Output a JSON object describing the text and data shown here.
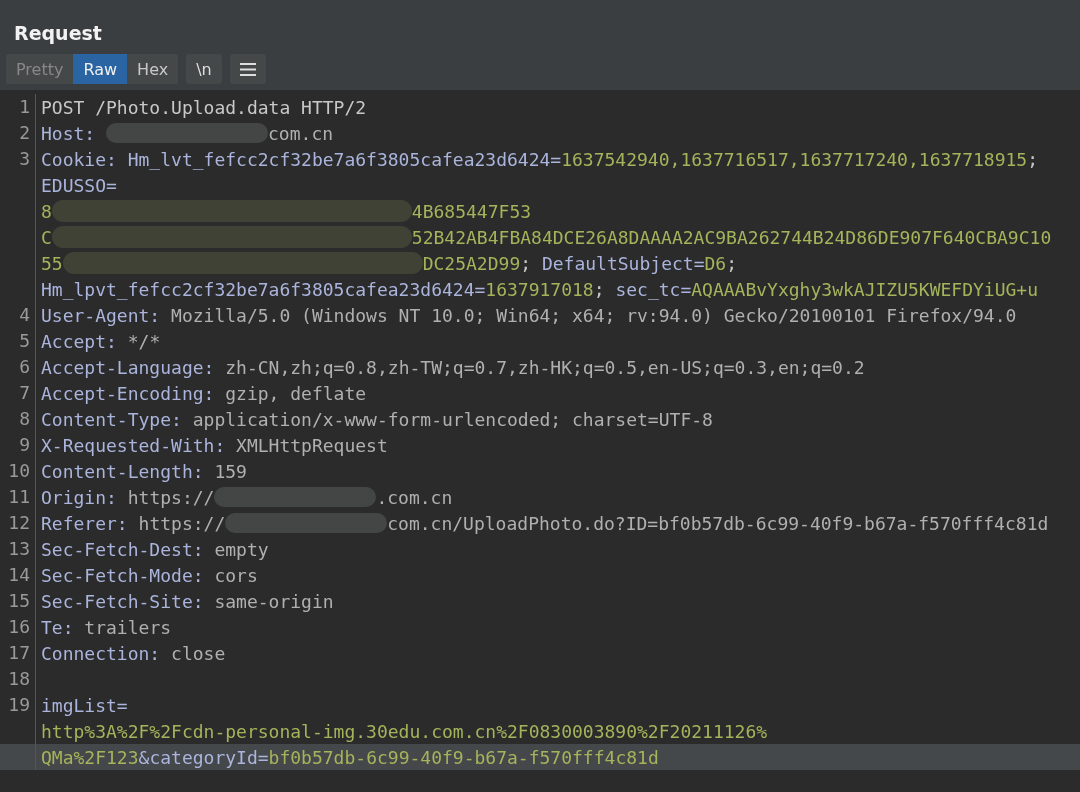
{
  "panel": {
    "title": "Request"
  },
  "view_tabs": [
    {
      "label": "Pretty",
      "selected": false
    },
    {
      "label": "Raw",
      "selected": true
    },
    {
      "label": "Hex",
      "selected": false
    }
  ],
  "newline_toggle": {
    "label": "\\n"
  },
  "editor": {
    "rows": [
      {
        "number": "1",
        "selected": false,
        "segments": [
          {
            "kind": "plain",
            "text": "POST /Photo.Upload.data HTTP/2"
          }
        ]
      },
      {
        "number": "2",
        "selected": false,
        "segments": [
          {
            "kind": "name",
            "text": "Host: "
          },
          {
            "kind": "smudge"
          },
          {
            "kind": "value",
            "text": "com.cn"
          }
        ]
      },
      {
        "number": "3",
        "selected": false,
        "segments": [
          {
            "kind": "name",
            "text": "Cookie: Hm_lvt_fefcc2cf32be7a6f3805cafea23d6424="
          },
          {
            "kind": "cookie",
            "text": "1637542940,1637716517,1637717240,1637718915"
          },
          {
            "kind": "plain",
            "text": ";"
          }
        ]
      },
      {
        "selected": false,
        "segments": [
          {
            "kind": "name",
            "text": "EDUSSO="
          }
        ]
      },
      {
        "selected": false,
        "segments": [
          {
            "kind": "cookie",
            "text": "8"
          },
          {
            "kind": "smudge-wide"
          },
          {
            "kind": "cookie",
            "text": "4B685447F53"
          }
        ]
      },
      {
        "selected": false,
        "segments": [
          {
            "kind": "cookie",
            "text": "C"
          },
          {
            "kind": "smudge-wide"
          },
          {
            "kind": "cookie",
            "text": "52B42AB4FBA84DCE26A8DAAAA2AC9BA262744B24D86DE907F640CBA9C10"
          }
        ]
      },
      {
        "selected": false,
        "segments": [
          {
            "kind": "cookie",
            "text": "55"
          },
          {
            "kind": "smudge-wide"
          },
          {
            "kind": "cookie",
            "text": "DC25A2D99"
          },
          {
            "kind": "plain",
            "text": "; "
          },
          {
            "kind": "name",
            "text": "DefaultSubject="
          },
          {
            "kind": "cookie",
            "text": "D6"
          },
          {
            "kind": "plain",
            "text": ";"
          }
        ]
      },
      {
        "selected": false,
        "segments": [
          {
            "kind": "name",
            "text": "Hm_lpvt_fefcc2cf32be7a6f3805cafea23d6424="
          },
          {
            "kind": "cookie",
            "text": "1637917018"
          },
          {
            "kind": "plain",
            "text": "; "
          },
          {
            "kind": "name",
            "text": "sec_tc="
          },
          {
            "kind": "cookie",
            "text": "AQAAABvYxghy3wkAJIZU5KWEFDYiUG+u"
          }
        ]
      },
      {
        "number": "4",
        "selected": false,
        "segments": [
          {
            "kind": "name",
            "text": "User-Agent: "
          },
          {
            "kind": "value",
            "text": "Mozilla/5.0 (Windows NT 10.0; Win64; x64; rv:94.0) Gecko/20100101 Firefox/94.0"
          }
        ]
      },
      {
        "number": "5",
        "selected": false,
        "segments": [
          {
            "kind": "name",
            "text": "Accept: "
          },
          {
            "kind": "value",
            "text": "*/*"
          }
        ]
      },
      {
        "number": "6",
        "selected": false,
        "segments": [
          {
            "kind": "name",
            "text": "Accept-Language: "
          },
          {
            "kind": "value",
            "text": "zh-CN,zh;q=0.8,zh-TW;q=0.7,zh-HK;q=0.5,en-US;q=0.3,en;q=0.2"
          }
        ]
      },
      {
        "number": "7",
        "selected": false,
        "segments": [
          {
            "kind": "name",
            "text": "Accept-Encoding: "
          },
          {
            "kind": "value",
            "text": "gzip, deflate"
          }
        ]
      },
      {
        "number": "8",
        "selected": false,
        "segments": [
          {
            "kind": "name",
            "text": "Content-Type: "
          },
          {
            "kind": "value",
            "text": "application/x-www-form-urlencoded; charset=UTF-8"
          }
        ]
      },
      {
        "number": "9",
        "selected": false,
        "segments": [
          {
            "kind": "name",
            "text": "X-Requested-With: "
          },
          {
            "kind": "value",
            "text": "XMLHttpRequest"
          }
        ]
      },
      {
        "number": "10",
        "selected": false,
        "segments": [
          {
            "kind": "name",
            "text": "Content-Length: "
          },
          {
            "kind": "value",
            "text": "159"
          }
        ]
      },
      {
        "number": "11",
        "selected": false,
        "segments": [
          {
            "kind": "name",
            "text": "Origin: "
          },
          {
            "kind": "value",
            "text": "https://"
          },
          {
            "kind": "smudge"
          },
          {
            "kind": "value",
            "text": ".com.cn"
          }
        ]
      },
      {
        "number": "12",
        "selected": false,
        "segments": [
          {
            "kind": "name",
            "text": "Referer: "
          },
          {
            "kind": "value",
            "text": "https://"
          },
          {
            "kind": "smudge"
          },
          {
            "kind": "value",
            "text": "com.cn/UploadPhoto.do?ID=bf0b57db-6c99-40f9-b67a-f570fff4c81d"
          }
        ]
      },
      {
        "number": "13",
        "selected": false,
        "segments": [
          {
            "kind": "name",
            "text": "Sec-Fetch-Dest: "
          },
          {
            "kind": "value",
            "text": "empty"
          }
        ]
      },
      {
        "number": "14",
        "selected": false,
        "segments": [
          {
            "kind": "name",
            "text": "Sec-Fetch-Mode: "
          },
          {
            "kind": "value",
            "text": "cors"
          }
        ]
      },
      {
        "number": "15",
        "selected": false,
        "segments": [
          {
            "kind": "name",
            "text": "Sec-Fetch-Site: "
          },
          {
            "kind": "value",
            "text": "same-origin"
          }
        ]
      },
      {
        "number": "16",
        "selected": false,
        "segments": [
          {
            "kind": "name",
            "text": "Te: "
          },
          {
            "kind": "value",
            "text": "trailers"
          }
        ]
      },
      {
        "number": "17",
        "selected": false,
        "segments": [
          {
            "kind": "name",
            "text": "Connection: "
          },
          {
            "kind": "value",
            "text": "close"
          }
        ]
      },
      {
        "number": "18",
        "selected": false,
        "segments": []
      },
      {
        "number": "19",
        "selected": false,
        "segments": [
          {
            "kind": "name",
            "text": "imgList="
          }
        ]
      },
      {
        "selected": false,
        "segments": [
          {
            "kind": "cookie",
            "text": "http%3A%2F%2Fcdn-personal-img.30edu.com.cn%2F0830003890%2F20211126%"
          }
        ]
      },
      {
        "selected": true,
        "segments": [
          {
            "kind": "cookie",
            "text": "QMa%2F123"
          },
          {
            "kind": "name",
            "text": "&categoryId="
          },
          {
            "kind": "cookie",
            "text": "bf0b57db-6c99-40f9-b67a-f570fff4c81d"
          }
        ]
      }
    ]
  }
}
